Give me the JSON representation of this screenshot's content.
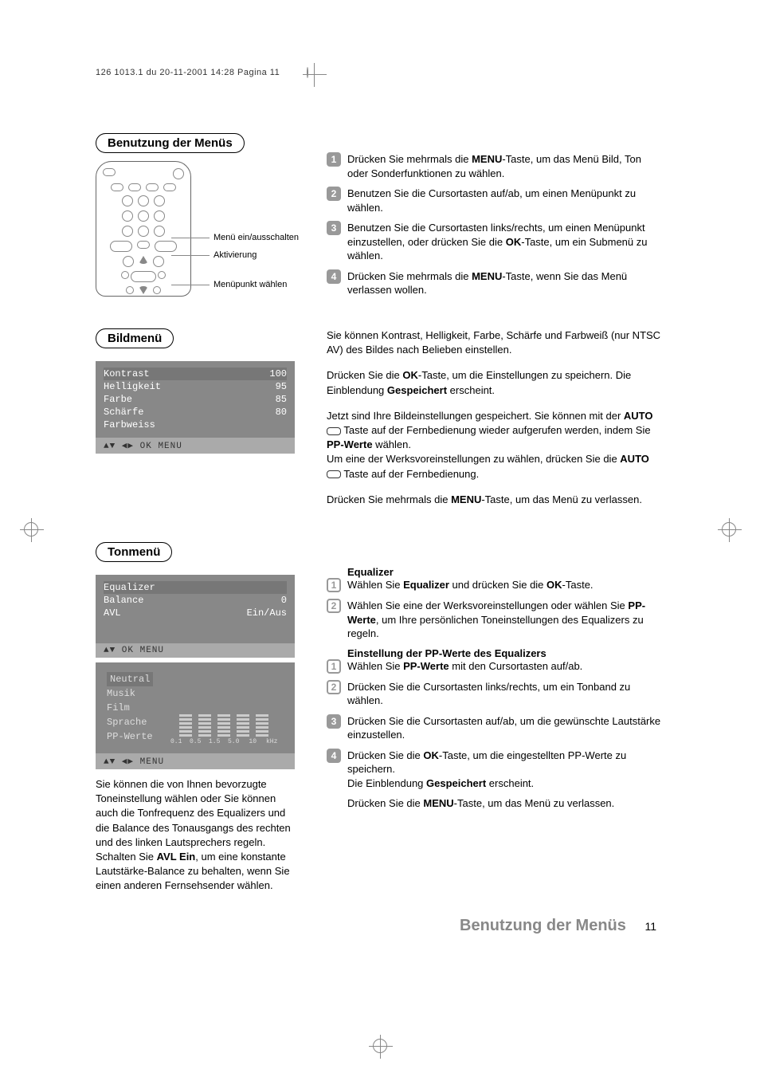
{
  "header": "126 1013.1 du  20-11-2001  14:28  Pagina 11",
  "section1": {
    "title": "Benutzung der Menüs",
    "remote_labels": {
      "l1": "Menü ein/ausschalten",
      "l2": "Aktivierung",
      "l3": "Menüpunkt wählen"
    },
    "steps": {
      "s1_a": "Drücken Sie mehrmals die ",
      "s1_b": "MENU",
      "s1_c": "-Taste, um das Menü Bild, Ton oder Sonderfunktionen zu wählen.",
      "s2": "Benutzen Sie die Cursortasten auf/ab, um einen Menüpunkt zu wählen.",
      "s3_a": "Benutzen Sie die Cursortasten links/rechts, um einen Menüpunkt einzustellen, oder drücken Sie die ",
      "s3_b": "OK",
      "s3_c": "-Taste, um ein Submenü zu wählen.",
      "s4_a": "Drücken Sie mehrmals die ",
      "s4_b": "MENU",
      "s4_c": "-Taste, wenn Sie das Menü verlassen wollen."
    }
  },
  "section2": {
    "title": "Bildmenü",
    "osd": {
      "r1": {
        "label": "Kontrast",
        "val": "100"
      },
      "r2": {
        "label": "Helligkeit",
        "val": "95"
      },
      "r3": {
        "label": "Farbe",
        "val": "85"
      },
      "r4": {
        "label": "Schärfe",
        "val": "80"
      },
      "r5": {
        "label": "Farbweiss",
        "val": ""
      },
      "footer": "▲▼ ◀▶   OK MENU"
    },
    "right": {
      "p1": "Sie können Kontrast, Helligkeit, Farbe, Schärfe und Farbweiß (nur NTSC AV) des Bildes nach Belieben einstellen.",
      "p2_a": "Drücken Sie die ",
      "p2_b": "OK",
      "p2_c": "-Taste, um die Einstellungen zu speichern. Die Einblendung ",
      "p2_d": "Gespeichert",
      "p2_e": " erscheint.",
      "p3_a": "Jetzt sind Ihre Bildeinstellungen gespeichert.  Sie können mit der ",
      "p3_b": "AUTO",
      "p3_c": "Taste auf der Fernbedienung wieder aufgerufen werden, indem Sie ",
      "p3_d": "PP-Werte",
      "p3_e": " wählen.",
      "p3_f": "Um eine der Werksvoreinstellungen zu wählen, drücken Sie die ",
      "p3_g": "AUTO",
      "p3_h": "Taste auf der Fernbedienung.",
      "p4_a": "Drücken Sie mehrmals die ",
      "p4_b": "MENU",
      "p4_c": "-Taste, um das Menü zu verlassen."
    }
  },
  "section3": {
    "title": "Tonmenü",
    "osd1": {
      "r1": {
        "label": "Equalizer",
        "val": ""
      },
      "r2": {
        "label": "Balance",
        "val": "0"
      },
      "r3": {
        "label": "AVL",
        "val": "Ein/Aus"
      },
      "footer": "▲▼ OK MENU"
    },
    "osd2": {
      "presets": {
        "p1": "Neutral",
        "p2": "Musik",
        "p3": "Film",
        "p4": "Sprache",
        "p5": "PP-Werte"
      },
      "freq": {
        "f1": "0.1",
        "f2": "0.5",
        "f3": "1.5",
        "f4": "5.0",
        "f5": "10",
        "unit": "kHz"
      },
      "footer": "▲▼ ◀▶    MENU"
    },
    "note_a": "Sie können die von Ihnen bevorzugte Toneinstellung wählen oder Sie können auch die Tonfrequenz des Equalizers und die Balance des Tonausgangs des rechten und des linken Lautsprechers regeln. Schalten Sie ",
    "note_b": "AVL Ein",
    "note_c": ", um eine konstante Lautstärke-Balance zu behalten, wenn Sie einen anderen Fernsehsender wählen.",
    "right": {
      "heading1": "Equalizer",
      "e1_a": "Wählen Sie ",
      "e1_b": "Equalizer",
      "e1_c": " und drücken Sie die ",
      "e1_d": "OK",
      "e1_e": "-Taste.",
      "e2_a": "Wählen Sie eine der Werksvoreinstellungen oder wählen Sie ",
      "e2_b": "PP-Werte",
      "e2_c": ", um Ihre persönlichen Toneinstellungen des Equalizers zu regeln.",
      "heading2": "Einstellung der PP-Werte des Equalizers",
      "pp1_a": "Wählen Sie ",
      "pp1_b": "PP-Werte",
      "pp1_c": " mit den Cursortasten auf/ab.",
      "pp2": "Drücken Sie die Cursortasten links/rechts, um ein Tonband zu wählen.",
      "pp3": "Drücken Sie die Cursortasten auf/ab, um die gewünschte Lautstärke einzustellen.",
      "pp4_a": "Drücken Sie die ",
      "pp4_b": "OK",
      "pp4_c": "-Taste, um die eingestellten PP-Werte zu speichern.",
      "pp4_d": "Die Einblendung ",
      "pp4_e": "Gespeichert",
      "pp4_f": " erscheint.",
      "last_a": "Drücken Sie die ",
      "last_b": "MENU",
      "last_c": "-Taste, um das Menü zu verlassen."
    }
  },
  "footer": {
    "text": "Benutzung der Menüs",
    "page": "11"
  }
}
